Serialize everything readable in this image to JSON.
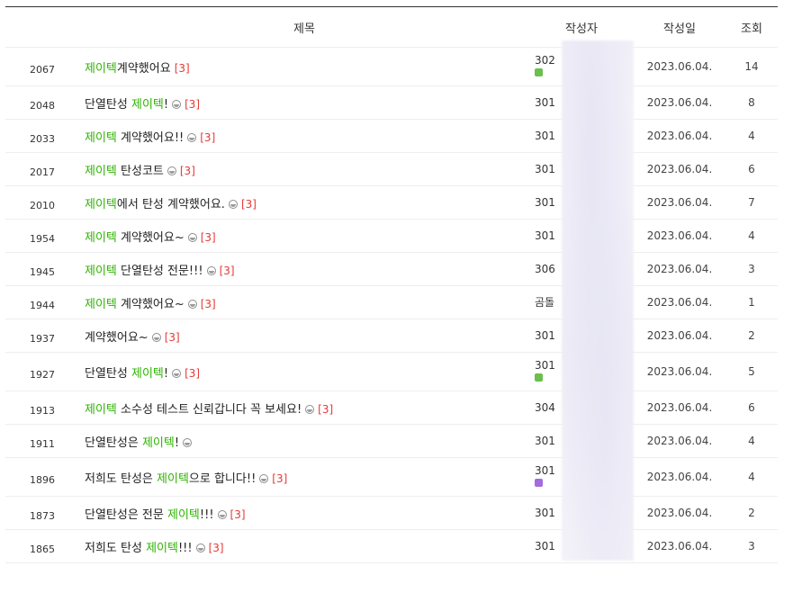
{
  "header": {
    "title": "제목",
    "author": "작성자",
    "date": "작성일",
    "views": "조회"
  },
  "colors": {
    "keyword": "#2db400",
    "comment_count": "#e53935",
    "badge_green": "#6cbf4d",
    "badge_purple": "#a36be0"
  },
  "rows": [
    {
      "num": "2067",
      "title": [
        {
          "t": "제이텍",
          "kw": true
        },
        {
          "t": "계약했어요"
        }
      ],
      "img": false,
      "comments": "[3]",
      "author": "302",
      "badge": "green",
      "date": "2023.06.04.",
      "views": "14"
    },
    {
      "num": "2048",
      "title": [
        {
          "t": "단열탄성 "
        },
        {
          "t": "제이텍",
          "kw": true
        },
        {
          "t": "!"
        }
      ],
      "img": true,
      "comments": "[3]",
      "author": "301",
      "badge": null,
      "date": "2023.06.04.",
      "views": "8"
    },
    {
      "num": "2033",
      "title": [
        {
          "t": "제이텍",
          "kw": true
        },
        {
          "t": " 계약했어요!!"
        }
      ],
      "img": true,
      "comments": "[3]",
      "author": "301",
      "badge": null,
      "date": "2023.06.04.",
      "views": "4"
    },
    {
      "num": "2017",
      "title": [
        {
          "t": "제이텍",
          "kw": true
        },
        {
          "t": " 탄성코트"
        }
      ],
      "img": true,
      "comments": "[3]",
      "author": "301",
      "badge": null,
      "date": "2023.06.04.",
      "views": "6"
    },
    {
      "num": "2010",
      "title": [
        {
          "t": "제이텍",
          "kw": true
        },
        {
          "t": "에서 탄성 계약했어요."
        }
      ],
      "img": true,
      "comments": "[3]",
      "author": "301",
      "badge": null,
      "date": "2023.06.04.",
      "views": "7"
    },
    {
      "num": "1954",
      "title": [
        {
          "t": "제이텍",
          "kw": true
        },
        {
          "t": " 계약했어요~"
        }
      ],
      "img": true,
      "comments": "[3]",
      "author": "301",
      "badge": null,
      "date": "2023.06.04.",
      "views": "4"
    },
    {
      "num": "1945",
      "title": [
        {
          "t": "제이텍",
          "kw": true
        },
        {
          "t": " 단열탄성 전문!!!"
        }
      ],
      "img": true,
      "comments": "[3]",
      "author": "306",
      "badge": null,
      "date": "2023.06.04.",
      "views": "3"
    },
    {
      "num": "1944",
      "title": [
        {
          "t": "제이텍",
          "kw": true
        },
        {
          "t": " 계약했어요~"
        }
      ],
      "img": true,
      "comments": "[3]",
      "author": "곰돌",
      "badge": null,
      "date": "2023.06.04.",
      "views": "1"
    },
    {
      "num": "1937",
      "title": [
        {
          "t": "계약했어요~"
        }
      ],
      "img": true,
      "comments": "[3]",
      "author": "301",
      "badge": null,
      "date": "2023.06.04.",
      "views": "2"
    },
    {
      "num": "1927",
      "title": [
        {
          "t": "단열탄성 "
        },
        {
          "t": "제이텍",
          "kw": true
        },
        {
          "t": "!"
        }
      ],
      "img": true,
      "comments": "[3]",
      "author": "301",
      "badge": "green",
      "date": "2023.06.04.",
      "views": "5"
    },
    {
      "num": "1913",
      "title": [
        {
          "t": "제이텍",
          "kw": true
        },
        {
          "t": " 소수성 테스트 신뢰갑니다 꼭 보세요!"
        }
      ],
      "img": true,
      "comments": "[3]",
      "author": "304",
      "badge": null,
      "date": "2023.06.04.",
      "views": "6"
    },
    {
      "num": "1911",
      "title": [
        {
          "t": "단열탄성은 "
        },
        {
          "t": "제이텍",
          "kw": true
        },
        {
          "t": "!"
        }
      ],
      "img": true,
      "comments": "",
      "author": "301",
      "badge": null,
      "date": "2023.06.04.",
      "views": "4"
    },
    {
      "num": "1896",
      "title": [
        {
          "t": "저희도 탄성은 "
        },
        {
          "t": "제이텍",
          "kw": true
        },
        {
          "t": "으로 합니다!!"
        }
      ],
      "img": true,
      "comments": "[3]",
      "author": "301",
      "badge": "purple",
      "date": "2023.06.04.",
      "views": "4"
    },
    {
      "num": "1873",
      "title": [
        {
          "t": "단열탄성은 전문 "
        },
        {
          "t": "제이텍",
          "kw": true
        },
        {
          "t": "!!!"
        }
      ],
      "img": true,
      "comments": "[3]",
      "author": "301",
      "badge": null,
      "date": "2023.06.04.",
      "views": "2"
    },
    {
      "num": "1865",
      "title": [
        {
          "t": "저희도 탄성 "
        },
        {
          "t": "제이텍",
          "kw": true
        },
        {
          "t": "!!!"
        }
      ],
      "img": true,
      "comments": "[3]",
      "author": "301",
      "badge": null,
      "date": "2023.06.04.",
      "views": "3"
    }
  ]
}
